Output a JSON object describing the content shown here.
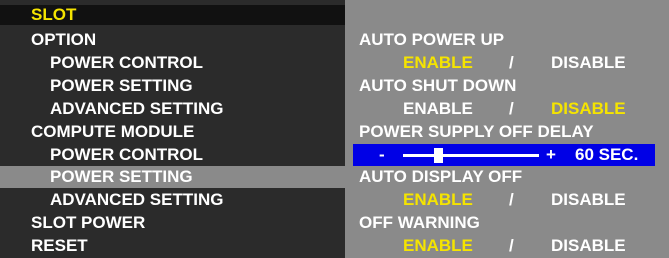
{
  "menu": {
    "title": "SLOT",
    "items": [
      {
        "label": "OPTION",
        "level": 0,
        "selected": false
      },
      {
        "label": "POWER CONTROL",
        "level": 1,
        "selected": false
      },
      {
        "label": "POWER SETTING",
        "level": 1,
        "selected": false
      },
      {
        "label": "ADVANCED SETTING",
        "level": 1,
        "selected": false
      },
      {
        "label": "COMPUTE MODULE",
        "level": 0,
        "selected": false
      },
      {
        "label": "POWER CONTROL",
        "level": 1,
        "selected": false
      },
      {
        "label": "POWER SETTING",
        "level": 1,
        "selected": true
      },
      {
        "label": "ADVANCED SETTING",
        "level": 1,
        "selected": false
      },
      {
        "label": "SLOT POWER",
        "level": 0,
        "selected": false
      },
      {
        "label": "RESET",
        "level": 0,
        "selected": false
      }
    ]
  },
  "settings": {
    "auto_power_up": {
      "label": "AUTO POWER UP",
      "enable": "ENABLE",
      "slash": "/",
      "disable": "DISABLE",
      "selected": "enable"
    },
    "auto_shut_down": {
      "label": "AUTO SHUT DOWN",
      "enable": "ENABLE",
      "slash": "/",
      "disable": "DISABLE",
      "selected": "disable"
    },
    "power_supply_off_delay": {
      "label": "POWER SUPPLY OFF DELAY",
      "minus": "-",
      "plus": "+",
      "value_text": "60 SEC.",
      "level_fraction": 0.26
    },
    "auto_display_off": {
      "label": "AUTO DISPLAY OFF",
      "enable": "ENABLE",
      "slash": "/",
      "disable": "DISABLE",
      "selected": "enable"
    },
    "off_warning": {
      "label": "OFF WARNING",
      "enable": "ENABLE",
      "slash": "/",
      "disable": "DISABLE",
      "selected": "enable"
    }
  },
  "colors": {
    "highlight_text": "#f5e400",
    "slider_bg": "#0000e6",
    "left_panel_bg": "#2b2b2b",
    "right_panel_bg": "#8a8a8a"
  }
}
